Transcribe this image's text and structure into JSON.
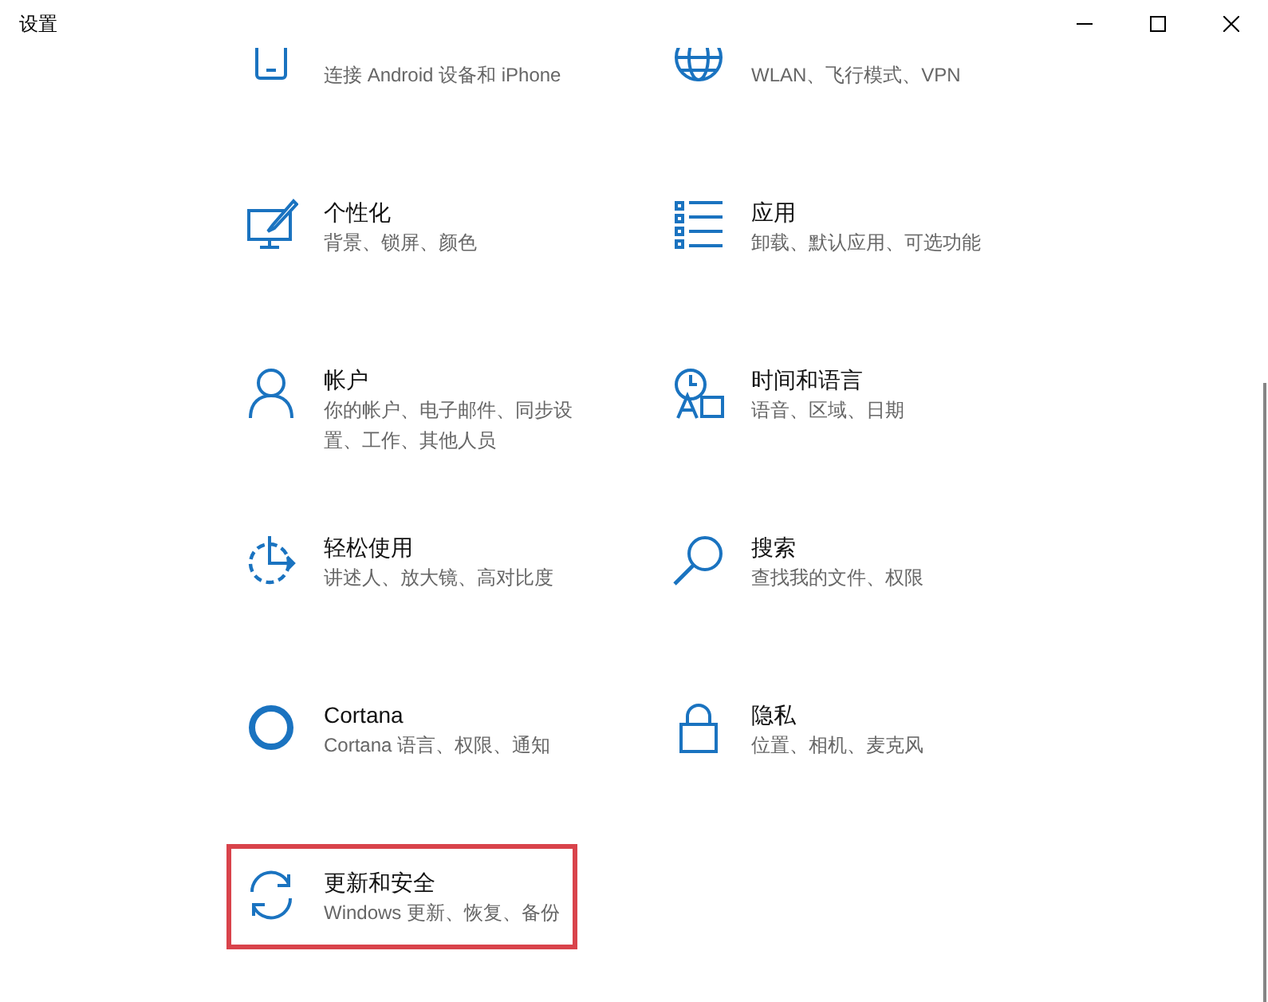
{
  "window": {
    "title": "设置"
  },
  "tiles": [
    {
      "description": "连接 Android 设备和 iPhone",
      "highlighted": false
    },
    {
      "description": "WLAN、飞行模式、VPN",
      "highlighted": false
    },
    {
      "title": "个性化",
      "description": "背景、锁屏、颜色",
      "highlighted": false
    },
    {
      "title": "应用",
      "description": "卸载、默认应用、可选功能",
      "highlighted": false
    },
    {
      "title": "帐户",
      "description": "你的帐户、电子邮件、同步设置、工作、其他人员",
      "highlighted": false
    },
    {
      "title": "时间和语言",
      "description": "语音、区域、日期",
      "highlighted": false
    },
    {
      "title": "轻松使用",
      "description": "讲述人、放大镜、高对比度",
      "highlighted": false
    },
    {
      "title": "搜索",
      "description": "查找我的文件、权限",
      "highlighted": false
    },
    {
      "title": "Cortana",
      "description": "Cortana 语言、权限、通知",
      "highlighted": false
    },
    {
      "title": "隐私",
      "description": "位置、相机、麦克风",
      "highlighted": false
    },
    {
      "title": "更新和安全",
      "description": "Windows 更新、恢复、备份",
      "highlighted": true
    }
  ]
}
